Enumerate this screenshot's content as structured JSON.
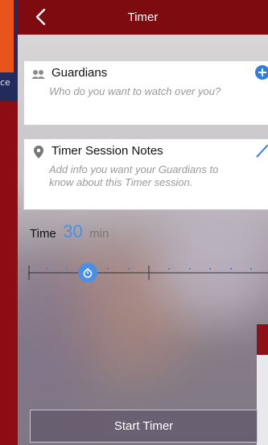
{
  "background_app": {
    "edge_text": "ce"
  },
  "navbar": {
    "title": "Timer",
    "back_icon": "chevron-left-icon"
  },
  "guardians": {
    "label": "Guardians",
    "placeholder": "Who do you want to watch over you?",
    "icon": "people-icon",
    "action_icon": "plus-circle-icon"
  },
  "notes": {
    "label": "Timer Session Notes",
    "placeholder": "Add info you want your Guardians to know about this Timer session.",
    "icon": "location-pin-icon",
    "action_icon": "pencil-icon"
  },
  "time": {
    "label": "Time",
    "value": "30",
    "unit": "min"
  },
  "slider": {
    "value_minutes": 30
  },
  "start_button": {
    "label": "Start Timer"
  },
  "colors": {
    "navbar": "#7d0b10",
    "accent": "#4a90e2"
  }
}
